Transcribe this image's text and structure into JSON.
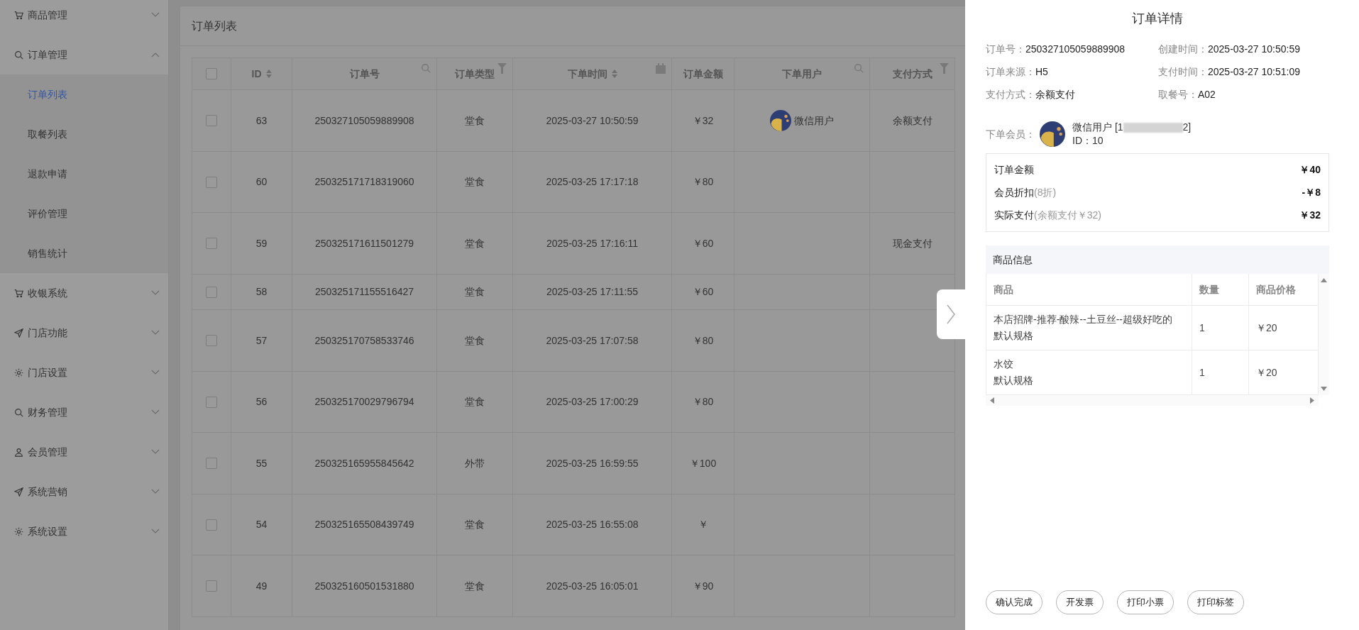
{
  "sidebar": {
    "items": [
      {
        "label": "商品管理",
        "expanded": false
      },
      {
        "label": "订单管理",
        "expanded": true,
        "children": [
          {
            "label": "订单列表",
            "selected": true
          },
          {
            "label": "取餐列表",
            "selected": false
          },
          {
            "label": "退款申请",
            "selected": false
          },
          {
            "label": "评价管理",
            "selected": false
          },
          {
            "label": "销售统计",
            "selected": false
          }
        ]
      },
      {
        "label": "收银系统",
        "expanded": false
      },
      {
        "label": "门店功能",
        "expanded": false
      },
      {
        "label": "门店设置",
        "expanded": false
      },
      {
        "label": "财务管理",
        "expanded": false
      },
      {
        "label": "会员管理",
        "expanded": false
      },
      {
        "label": "系统营销",
        "expanded": false
      },
      {
        "label": "系统设置",
        "expanded": false
      }
    ]
  },
  "card": {
    "title": "订单列表"
  },
  "table": {
    "columns": [
      {
        "label": "ID"
      },
      {
        "label": "订单号"
      },
      {
        "label": "订单类型"
      },
      {
        "label": "下单时间"
      },
      {
        "label": "订单金额"
      },
      {
        "label": "下单用户"
      },
      {
        "label": "支付方式"
      }
    ],
    "all_checked": false,
    "rows": [
      {
        "checked": false,
        "id": "63",
        "order_no": "250327105059889908",
        "type": "堂食",
        "time": "2025-03-27 10:50:59",
        "amount": "￥32",
        "user": "微信用户",
        "payment": "余额支付"
      },
      {
        "checked": false,
        "id": "60",
        "order_no": "250325171718319060",
        "type": "堂食",
        "time": "2025-03-25 17:17:18",
        "amount": "￥80"
      },
      {
        "checked": false,
        "id": "59",
        "order_no": "250325171611501279",
        "type": "堂食",
        "time": "2025-03-25 17:16:11",
        "amount": "￥60",
        "payment": "现金支付"
      },
      {
        "checked": false,
        "id": "58",
        "order_no": "250325171155516427",
        "type": "堂食",
        "time": "2025-03-25 17:11:55",
        "amount": "￥60"
      },
      {
        "checked": false,
        "id": "57",
        "order_no": "250325170758533746",
        "type": "堂食",
        "time": "2025-03-25 17:07:58",
        "amount": "￥80"
      },
      {
        "checked": false,
        "id": "56",
        "order_no": "250325170029796794",
        "type": "堂食",
        "time": "2025-03-25 17:00:29",
        "amount": "￥80"
      },
      {
        "checked": false,
        "id": "55",
        "order_no": "250325165955845642",
        "type": "外带",
        "time": "2025-03-25 16:59:55",
        "amount": "￥100"
      },
      {
        "checked": false,
        "id": "54",
        "order_no": "250325165508439749",
        "type": "堂食",
        "time": "2025-03-25 16:55:08",
        "amount": "￥"
      },
      {
        "checked": false,
        "id": "49",
        "order_no": "250325160501531880",
        "type": "堂食",
        "time": "2025-03-25 16:05:01",
        "amount": "￥90"
      }
    ]
  },
  "drawer": {
    "title": "订单详情",
    "info": [
      {
        "label": "订单号：",
        "value": "250327105059889908"
      },
      {
        "label": "创建时间：",
        "value": "2025-03-27 10:50:59"
      },
      {
        "label": "订单来源：",
        "value": "H5"
      },
      {
        "label": "支付时间：",
        "value": "2025-03-27 10:51:09"
      },
      {
        "label": "支付方式：",
        "value": "余额支付"
      },
      {
        "label": "取餐号：",
        "value": "A02"
      }
    ],
    "member": {
      "label": "下单会员：",
      "name": "微信用户 [1",
      "name_end": "2]",
      "id": "ID：10"
    },
    "summary": [
      {
        "label": "订单金额",
        "value": "￥40"
      },
      {
        "label": "会员折扣",
        "note": "(8折)",
        "value": "-￥8"
      },
      {
        "label": "实际支付",
        "note": "(余额支付￥32)",
        "value": "￥32"
      }
    ],
    "goods": {
      "title": "商品信息",
      "columns": [
        "商品",
        "数量",
        "商品价格"
      ],
      "rows": [
        {
          "name": "本店招牌-推荐-酸辣--土豆丝--超级好吃的",
          "spec": "默认规格",
          "qty": "1",
          "price": "￥20"
        },
        {
          "name": "水饺",
          "spec": "默认规格",
          "qty": "1",
          "price": "￥20"
        }
      ]
    },
    "buttons": [
      "确认完成",
      "开发票",
      "打印小票",
      "打印标签"
    ]
  }
}
